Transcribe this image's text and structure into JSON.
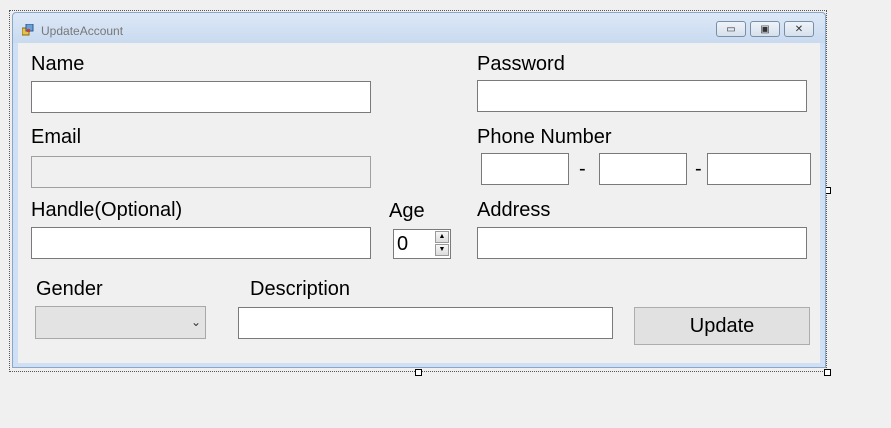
{
  "window": {
    "title": "UpdateAccount",
    "minimize_glyph": "▭",
    "maximize_glyph": "▣",
    "close_glyph": "✕"
  },
  "form": {
    "name_label": "Name",
    "name_value": "",
    "password_label": "Password",
    "password_value": "",
    "email_label": "Email",
    "email_value": "",
    "phone_label": "Phone Number",
    "phone_part1": "",
    "phone_part2": "",
    "phone_part3": "",
    "phone_sep1": "-",
    "phone_sep2": "-",
    "handle_label": "Handle(Optional)",
    "handle_value": "",
    "age_label": "Age",
    "age_value": "0",
    "address_label": "Address",
    "address_value": "",
    "gender_label": "Gender",
    "gender_value": "",
    "description_label": "Description",
    "description_value": "",
    "update_button": "Update"
  },
  "icons": {
    "app": "app-icon",
    "spin_up": "chevron-up-icon",
    "spin_down": "chevron-down-icon",
    "combo": "chevron-down-icon"
  }
}
